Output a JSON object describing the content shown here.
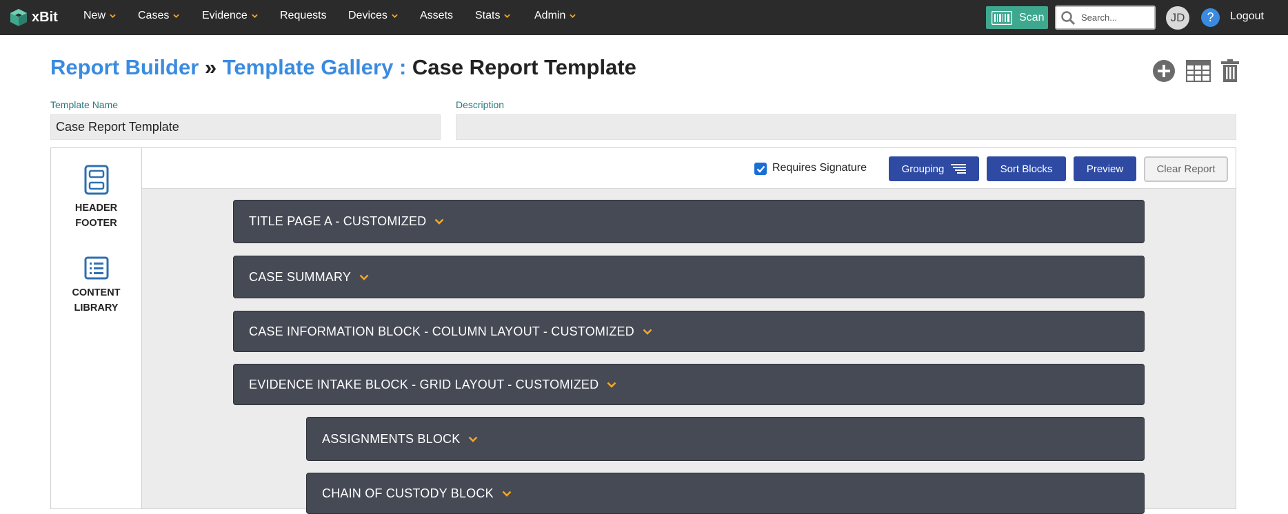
{
  "app": {
    "logo_text": "xBit",
    "nav": [
      {
        "label": "New",
        "dropdown": true
      },
      {
        "label": "Cases",
        "dropdown": true
      },
      {
        "label": "Evidence",
        "dropdown": true
      },
      {
        "label": "Requests",
        "dropdown": false
      },
      {
        "label": "Devices",
        "dropdown": true
      },
      {
        "label": "Assets",
        "dropdown": false
      },
      {
        "label": "Stats",
        "dropdown": true
      },
      {
        "label": "Admin",
        "dropdown": true
      }
    ],
    "scan_label": "Scan",
    "search_placeholder": "Search...",
    "avatar_initials": "JD",
    "help_label": "?",
    "logout_label": "Logout",
    "colors": {
      "accent": "#3a8be0",
      "scan": "#3ea88f",
      "nav_bg": "#2b2b2b",
      "caret": "#f5a623",
      "button": "#2e4aa3",
      "block": "#454a55"
    }
  },
  "page": {
    "breadcrumb": {
      "root": "Report Builder",
      "sep1": "»",
      "gallery": "Template Gallery :",
      "current": "Case Report Template"
    },
    "actions": [
      "add-circle-icon",
      "table-icon",
      "trash-icon"
    ]
  },
  "form": {
    "template_name_label": "Template Name",
    "template_name_value": "Case Report Template",
    "description_label": "Description",
    "description_value": ""
  },
  "left_panel": {
    "items": [
      {
        "line1": "HEADER",
        "line2": "FOOTER",
        "icon": "header-footer-icon"
      },
      {
        "line1": "CONTENT",
        "line2": "LIBRARY",
        "icon": "content-library-icon"
      }
    ]
  },
  "toolbar": {
    "requires_signature_label": "Requires Signature",
    "requires_signature_checked": true,
    "grouping_label": "Grouping",
    "sort_blocks_label": "Sort Blocks",
    "preview_label": "Preview",
    "clear_report_label": "Clear Report"
  },
  "blocks": [
    {
      "label": "TITLE PAGE A - CUSTOMIZED"
    },
    {
      "label": "CASE SUMMARY"
    },
    {
      "label": "CASE INFORMATION BLOCK - COLUMN LAYOUT - CUSTOMIZED"
    },
    {
      "label": "EVIDENCE INTAKE BLOCK - GRID LAYOUT - CUSTOMIZED"
    },
    {
      "label": "ASSIGNMENTS BLOCK"
    },
    {
      "label": "CHAIN OF CUSTODY BLOCK"
    }
  ]
}
